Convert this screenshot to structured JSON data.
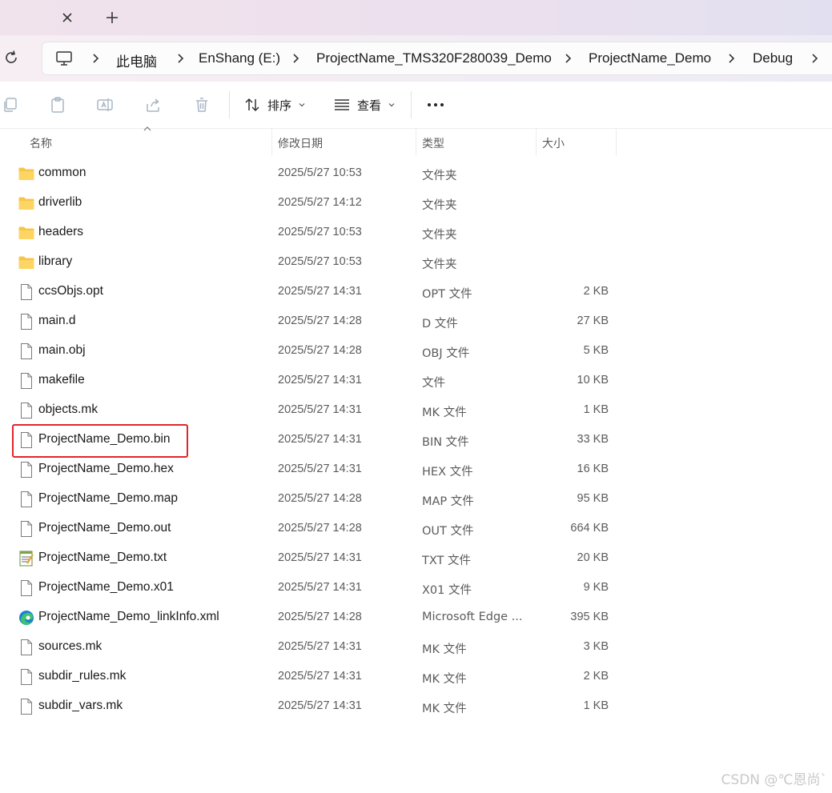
{
  "breadcrumb": [
    "此电脑",
    "EnShang (E:)",
    "ProjectName_TMS320F280039_Demo",
    "ProjectName_Demo",
    "Debug"
  ],
  "toolbar": {
    "sort_label": "排序",
    "view_label": "查看"
  },
  "columns": {
    "name": "名称",
    "modified": "修改日期",
    "type": "类型",
    "size": "大小"
  },
  "files": [
    {
      "name": "common",
      "date": "2025/5/27 10:53",
      "type": "文件夹",
      "size": "",
      "icon": "folder-icon"
    },
    {
      "name": "driverlib",
      "date": "2025/5/27 14:12",
      "type": "文件夹",
      "size": "",
      "icon": "folder-icon"
    },
    {
      "name": "headers",
      "date": "2025/5/27 10:53",
      "type": "文件夹",
      "size": "",
      "icon": "folder-icon"
    },
    {
      "name": "library",
      "date": "2025/5/27 10:53",
      "type": "文件夹",
      "size": "",
      "icon": "folder-icon"
    },
    {
      "name": "ccsObjs.opt",
      "date": "2025/5/27 14:31",
      "type": "OPT 文件",
      "size": "2 KB",
      "icon": "file-icon"
    },
    {
      "name": "main.d",
      "date": "2025/5/27 14:28",
      "type": "D 文件",
      "size": "27 KB",
      "icon": "file-icon"
    },
    {
      "name": "main.obj",
      "date": "2025/5/27 14:28",
      "type": "OBJ 文件",
      "size": "5 KB",
      "icon": "file-icon"
    },
    {
      "name": "makefile",
      "date": "2025/5/27 14:31",
      "type": "文件",
      "size": "10 KB",
      "icon": "file-icon"
    },
    {
      "name": "objects.mk",
      "date": "2025/5/27 14:31",
      "type": "MK 文件",
      "size": "1 KB",
      "icon": "file-icon"
    },
    {
      "name": "ProjectName_Demo.bin",
      "date": "2025/5/27 14:31",
      "type": "BIN 文件",
      "size": "33 KB",
      "icon": "file-icon"
    },
    {
      "name": "ProjectName_Demo.hex",
      "date": "2025/5/27 14:31",
      "type": "HEX 文件",
      "size": "16 KB",
      "icon": "file-icon"
    },
    {
      "name": "ProjectName_Demo.map",
      "date": "2025/5/27 14:28",
      "type": "MAP 文件",
      "size": "95 KB",
      "icon": "file-icon"
    },
    {
      "name": "ProjectName_Demo.out",
      "date": "2025/5/27 14:28",
      "type": "OUT 文件",
      "size": "664 KB",
      "icon": "file-icon"
    },
    {
      "name": "ProjectName_Demo.txt",
      "date": "2025/5/27 14:31",
      "type": "TXT 文件",
      "size": "20 KB",
      "icon": "notepad-icon"
    },
    {
      "name": "ProjectName_Demo.x01",
      "date": "2025/5/27 14:31",
      "type": "X01 文件",
      "size": "9 KB",
      "icon": "file-icon"
    },
    {
      "name": "ProjectName_Demo_linkInfo.xml",
      "date": "2025/5/27 14:28",
      "type": "Microsoft Edge ...",
      "size": "395 KB",
      "icon": "edge-icon"
    },
    {
      "name": "sources.mk",
      "date": "2025/5/27 14:31",
      "type": "MK 文件",
      "size": "3 KB",
      "icon": "file-icon"
    },
    {
      "name": "subdir_rules.mk",
      "date": "2025/5/27 14:31",
      "type": "MK 文件",
      "size": "2 KB",
      "icon": "file-icon"
    },
    {
      "name": "subdir_vars.mk",
      "date": "2025/5/27 14:31",
      "type": "MK 文件",
      "size": "1 KB",
      "icon": "file-icon"
    }
  ],
  "watermark": "CSDN @℃恩尚`",
  "colors": {
    "highlight": "#e0262a",
    "folder": "#f7c54a"
  }
}
